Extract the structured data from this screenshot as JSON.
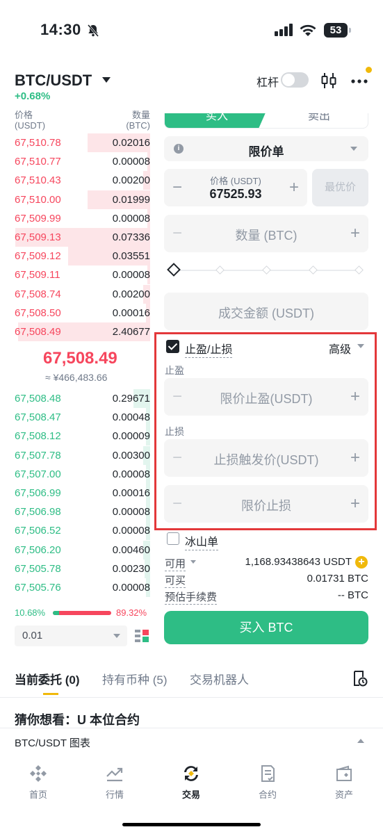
{
  "status_bar": {
    "time": "14:30",
    "battery": "53"
  },
  "header": {
    "pair": "BTC/USDT",
    "change": "+0.68%",
    "leverage_label": "杠杆"
  },
  "orderbook": {
    "price_label": "价格",
    "price_unit": "(USDT)",
    "qty_label": "数量",
    "qty_unit": "(BTC)",
    "asks": [
      {
        "price": "67,510.78",
        "qty": "0.02016",
        "depth": 0.46
      },
      {
        "price": "67,510.77",
        "qty": "0.00008",
        "depth": 0.02
      },
      {
        "price": "67,510.43",
        "qty": "0.00200",
        "depth": 0.05
      },
      {
        "price": "67,510.00",
        "qty": "0.01999",
        "depth": 0.46
      },
      {
        "price": "67,509.99",
        "qty": "0.00008",
        "depth": 0.02
      },
      {
        "price": "67,509.13",
        "qty": "0.07336",
        "depth": 0.99
      },
      {
        "price": "67,509.12",
        "qty": "0.03551",
        "depth": 0.6
      },
      {
        "price": "67,509.11",
        "qty": "0.00008",
        "depth": 0.02
      },
      {
        "price": "67,508.74",
        "qty": "0.00200",
        "depth": 0.05
      },
      {
        "price": "67,508.50",
        "qty": "0.00016",
        "depth": 0.03
      },
      {
        "price": "67,508.49",
        "qty": "2.40677",
        "depth": 0.97
      }
    ],
    "last_price": "67,508.49",
    "last_price_cny": "≈ ¥466,483.66",
    "bids": [
      {
        "price": "67,508.48",
        "qty": "0.29671",
        "depth": 0.12
      },
      {
        "price": "67,508.47",
        "qty": "0.00048",
        "depth": 0.03
      },
      {
        "price": "67,508.12",
        "qty": "0.00009",
        "depth": 0.03
      },
      {
        "price": "67,507.78",
        "qty": "0.00300",
        "depth": 0.05
      },
      {
        "price": "67,507.00",
        "qty": "0.00008",
        "depth": 0.03
      },
      {
        "price": "67,506.99",
        "qty": "0.00016",
        "depth": 0.03
      },
      {
        "price": "67,506.98",
        "qty": "0.00008",
        "depth": 0.03
      },
      {
        "price": "67,506.52",
        "qty": "0.00008",
        "depth": 0.03
      },
      {
        "price": "67,506.20",
        "qty": "0.00460",
        "depth": 0.05
      },
      {
        "price": "67,505.78",
        "qty": "0.00230",
        "depth": 0.04
      },
      {
        "price": "67,505.76",
        "qty": "0.00008",
        "depth": 0.03
      }
    ],
    "buy_ratio": "10.68%",
    "sell_ratio": "89.32%",
    "precision": "0.01"
  },
  "form": {
    "tab_buy": "买入",
    "tab_sell": "卖出",
    "order_type": "限价单",
    "price_label": "价格 (USDT)",
    "price_value": "67525.93",
    "best_price": "最优价",
    "qty_placeholder": "数量 (BTC)",
    "total_placeholder": "成交金额 (USDT)",
    "tpsl_label": "止盈/止损",
    "advanced": "高级",
    "tp_label": "止盈",
    "tp_placeholder": "限价止盈(USDT)",
    "sl_label": "止损",
    "sl_trigger_placeholder": "止损触发价(USDT)",
    "sl_limit_placeholder": "限价止损",
    "iceberg": "冰山单",
    "avail_label": "可用",
    "avail_value": "1,168.93438643 USDT",
    "canbuy_label": "可买",
    "canbuy_value": "0.01731 BTC",
    "fee_label": "预估手续费",
    "fee_value": "-- BTC",
    "buy_button": "买入 BTC"
  },
  "orders": {
    "tabs": [
      "当前委托 (0)",
      "持有币种 (5)",
      "交易机器人"
    ],
    "guess": "猜你想看：U 本位合约",
    "chart_row": "BTC/USDT 图表"
  },
  "nav": [
    "首页",
    "行情",
    "交易",
    "合约",
    "资产"
  ],
  "colors": {
    "buy": "#2ebd85",
    "sell": "#f6465d",
    "accent": "#f0b90b",
    "highlight_box": "#e3383a"
  }
}
